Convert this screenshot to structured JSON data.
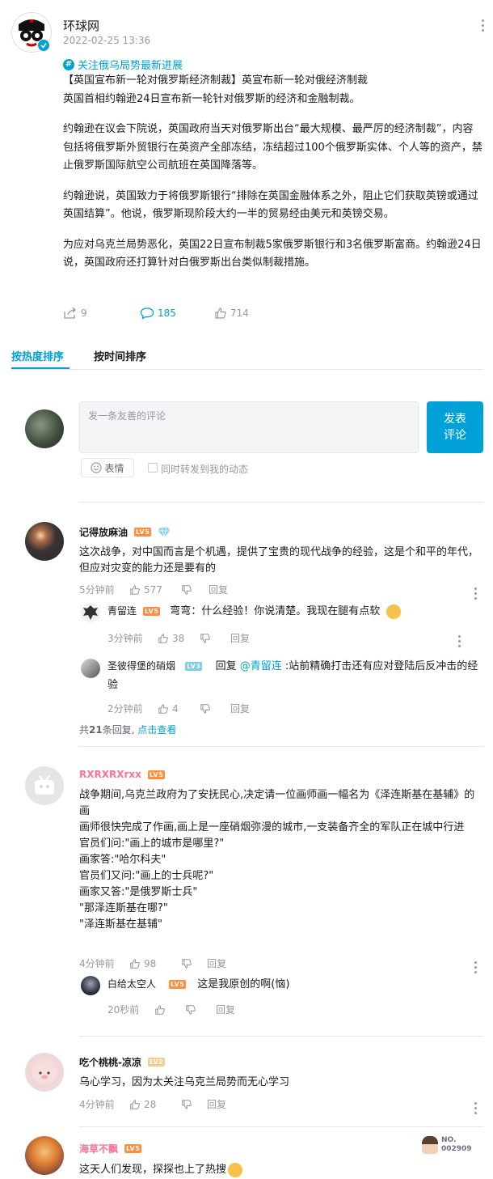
{
  "header": {
    "author": "环球网",
    "time": "2022-02-25 13:36",
    "topic": "关注俄乌局势最新进展"
  },
  "article": {
    "paragraphs": [
      "【英国宣布新一轮对俄罗斯经济制裁】英宣布新一轮对俄经济制裁\n英国首相约翰逊24日宣布新一轮针对俄罗斯的经济和金融制裁。",
      "约翰逊在议会下院说，英国政府当天对俄罗斯出台“最大规模、最严厉的经济制裁”，内容包括将俄罗斯外贸银行在英资产全部冻结，冻结超过100个俄罗斯实体、个人等的资产，禁止俄罗斯国际航空公司航班在英国降落等。",
      "约翰逊说，英国致力于将俄罗斯银行“排除在英国金融体系之外，阻止它们获取英镑或通过英国结算”。他说，俄罗斯现阶段大约一半的贸易经由美元和英镑交易。",
      "为应对乌克兰局势恶化，英国22日宣布制裁5家俄罗斯银行和3名俄罗斯富商。约翰逊24日说，英国政府还打算针对白俄罗斯出台类似制裁措施。"
    ]
  },
  "stats": {
    "share": "9",
    "comment": "185",
    "like": "714"
  },
  "tabs": {
    "hot": "按热度排序",
    "time": "按时间排序"
  },
  "composer": {
    "placeholder": "发一条友善的评论",
    "post_line1": "发表",
    "post_line2": "评论",
    "emoji": "表情",
    "forward": "同时转发到我的动态"
  },
  "labels": {
    "reply": "回复",
    "replied_prefix": "回复 "
  },
  "comments": [
    {
      "user": "记得放麻油",
      "level": "LV5",
      "text": "这次战争，对中国而言是个机遇，提供了宝贵的现代战争的经验，这是个和平的年代，但应对灾变的能力还是要有的",
      "time": "5分钟前",
      "likes": "577",
      "replies": [
        {
          "user": "青留连",
          "level": "LV5",
          "text": "弯弯：什么经验！你说清楚。我现在腿有点软",
          "time": "3分钟前",
          "likes": "38"
        },
        {
          "user": "圣彼得堡的硝烟",
          "level": "LV3",
          "at": "@青留连",
          "text": " :站前精确打击还有应对登陆后反冲击的经验",
          "time": "2分钟前",
          "likes": "4"
        }
      ],
      "summary_prefix": "共",
      "summary_count": "21",
      "summary_suffix": "条回复, ",
      "summary_link": "点击查看"
    },
    {
      "user": "RXRXRXrxx",
      "level": "LV5",
      "lines": [
        "战争期间,乌克兰政府为了安抚民心,决定请一位画师画一幅名为《泽连斯基在基辅》的画",
        "画师很快完成了作画,画上是一座硝烟弥漫的城市,一支装备齐全的军队正在城中行进",
        "官员们问:\"画上的城市是哪里?\"",
        "画家答:\"哈尔科夫\"",
        "官员们又问:\"画上的士兵呢?\"",
        "画家又答:\"是俄罗斯士兵\"",
        "\"那泽连斯基在哪?\"",
        "\"泽连斯基在基辅\""
      ],
      "time": "4分钟前",
      "likes": "98",
      "replies": [
        {
          "user": "白给太空人",
          "level": "LV5",
          "text": "这是我原创的啊(恼)",
          "time": "20秒前"
        }
      ]
    },
    {
      "user": "吃个桃桃-凉凉",
      "level": "LV2",
      "text": "乌心学习，因为太关注乌克兰局势而无心学习",
      "time": "4分钟前",
      "likes": "28"
    },
    {
      "user": "海草不飘",
      "level": "LV5",
      "text": "这天人们发现，探探也上了热搜",
      "badge_no": "NO.",
      "badge_num": "002909"
    }
  ],
  "colors": {
    "accent": "#00a1d6",
    "vip_name": "#fb7299",
    "text": "#18191c",
    "muted": "#9499a0"
  }
}
